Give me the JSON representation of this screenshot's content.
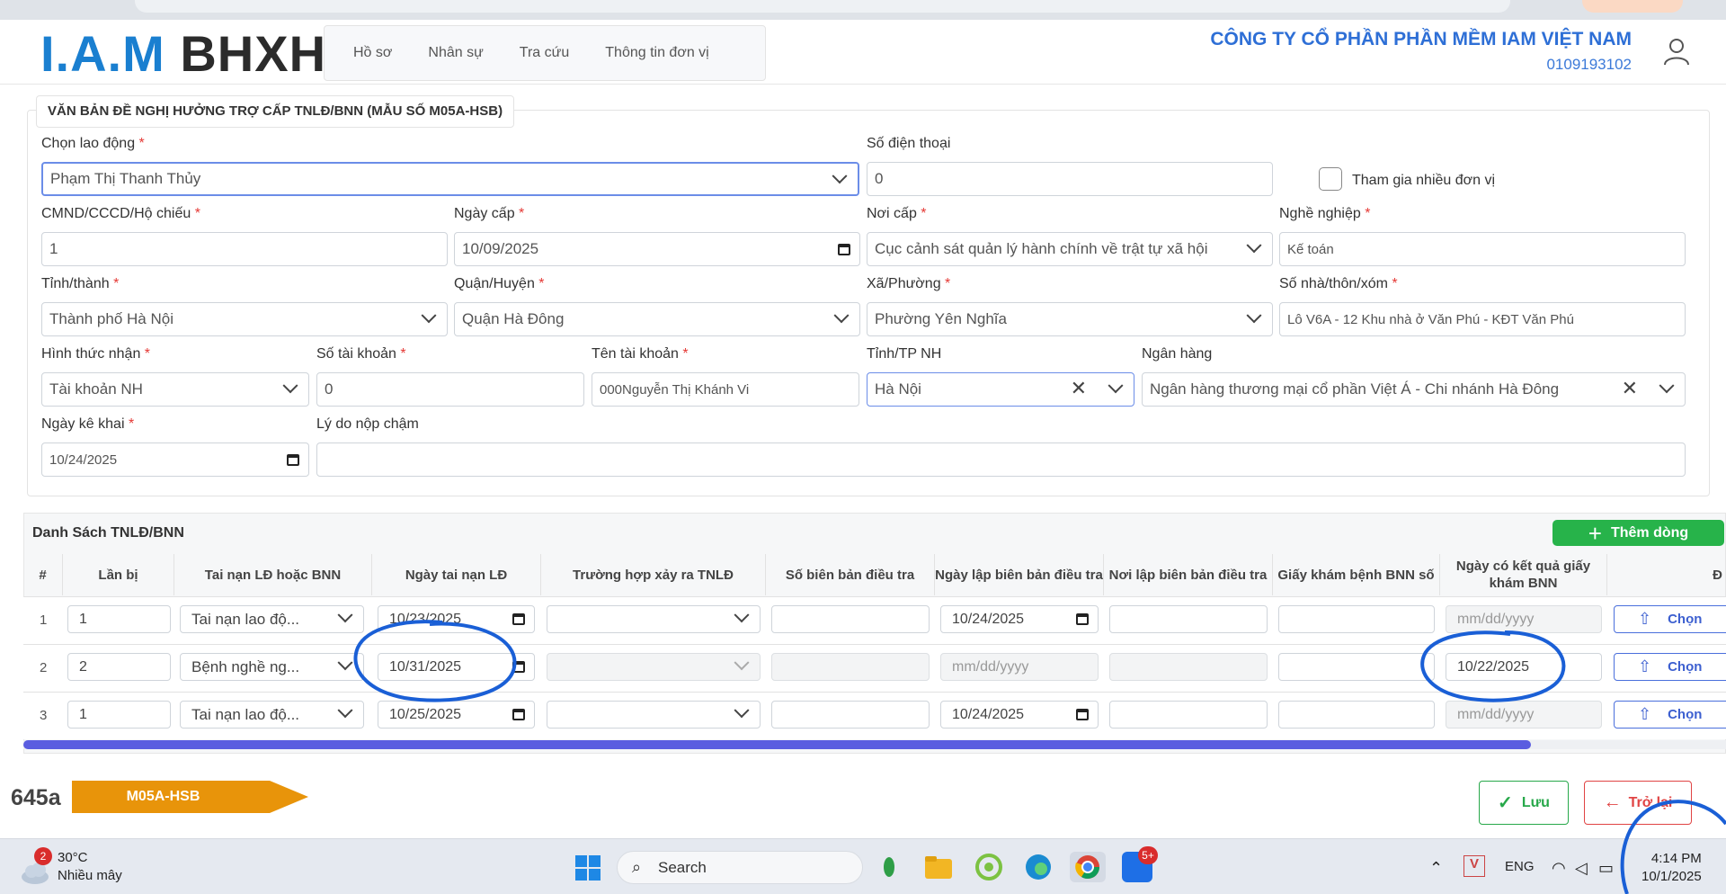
{
  "header": {
    "logo_iam": "I.A.M",
    "logo_bhxh": "BHXH",
    "nav": [
      "Hồ sơ",
      "Nhân sự",
      "Tra cứu",
      "Thông tin đơn vị"
    ],
    "company_name": "CÔNG TY CỔ PHẦN PHẦN MỀM IAM VIỆT NAM",
    "tax_code": "0109193102"
  },
  "form": {
    "title": "VĂN BẢN ĐỀ NGHỊ HƯỞNG TRỢ CẤP TNLĐ/BNN (MẪU SỐ M05A-HSB)",
    "required_mark": "*",
    "chon_lao_dong": {
      "label": "Chọn lao động",
      "value": "Phạm Thị Thanh Thủy"
    },
    "so_dien_thoai": {
      "label": "Số điện thoại",
      "value": "0"
    },
    "tham_gia": {
      "label": "Tham gia nhiều đơn vị"
    },
    "cmnd": {
      "label": "CMND/CCCD/Hộ chiếu",
      "value": "1"
    },
    "ngay_cap": {
      "label": "Ngày cấp",
      "value": "10/09/2025"
    },
    "noi_cap": {
      "label": "Nơi cấp",
      "value": "Cục cảnh sát quản lý hành chính về trật tự xã hội"
    },
    "nghe_nghiep": {
      "label": "Nghề nghiệp",
      "value": "Kế toán"
    },
    "tinh_thanh": {
      "label": "Tỉnh/thành",
      "value": "Thành phố Hà Nội"
    },
    "quan_huyen": {
      "label": "Quận/Huyện",
      "value": "Quận Hà Đông"
    },
    "xa_phuong": {
      "label": "Xã/Phường",
      "value": "Phường Yên Nghĩa"
    },
    "so_nha": {
      "label": "Số nhà/thôn/xóm",
      "value": "Lô V6A - 12 Khu nhà ở Văn Phú - KĐT Văn Phú"
    },
    "hinh_thuc_nhan": {
      "label": "Hình thức nhận",
      "value": "Tài khoản NH"
    },
    "so_tai_khoan": {
      "label": "Số tài khoản",
      "value": "0"
    },
    "ten_tai_khoan": {
      "label": "Tên tài khoản",
      "value": "000Nguyễn Thị Khánh Vi"
    },
    "tinh_tp_nh": {
      "label": "Tỉnh/TP NH",
      "value": "Hà Nội"
    },
    "ngan_hang": {
      "label": "Ngân hàng",
      "value": "Ngân hàng thương mại cổ phần Việt Á - Chi nhánh Hà Đông"
    },
    "ngay_ke_khai": {
      "label": "Ngày kê khai",
      "value": "10/24/2025"
    },
    "ly_do": {
      "label": "Lý do nộp chậm",
      "value": ""
    }
  },
  "table": {
    "title": "Danh Sách TNLĐ/BNN",
    "add_button": "Thêm dòng",
    "columns": [
      "#",
      "Lần bị",
      "Tai nạn LĐ hoặc BNN",
      "Ngày tai nạn LĐ",
      "Trường hợp xảy ra TNLĐ",
      "Số biên bản điều tra",
      "Ngày lập biên bản điều tra",
      "Nơi lập biên bản điều tra",
      "Giấy khám bệnh BNN số",
      "Ngày có kết quả giấy khám BNN",
      "Đ"
    ],
    "date_placeholder": "mm/dd/yyyy",
    "upload_label": "Chọn",
    "rows": [
      {
        "num": "1",
        "lan_bi": "1",
        "loai": "Tai nạn lao độ...",
        "ngay_tn": "10/23/2025",
        "ngay_lap": "10/24/2025",
        "ngay_kq": ""
      },
      {
        "num": "2",
        "lan_bi": "2",
        "loai": "Bệnh nghề ng...",
        "ngay_tn": "10/31/2025",
        "ngay_lap": "",
        "ngay_kq": "10/22/2025"
      },
      {
        "num": "3",
        "lan_bi": "1",
        "loai": "Tai nạn lao độ...",
        "ngay_tn": "10/25/2025",
        "ngay_lap": "10/24/2025",
        "ngay_kq": ""
      }
    ]
  },
  "footer": {
    "code": "645a",
    "banner": "M05A-HSB",
    "save": "Lưu",
    "back": "Trở lại"
  },
  "taskbar": {
    "weather_badge": "2",
    "temp": "30°C",
    "weather_desc": "Nhiều mây",
    "search": "Search",
    "zalo_badge": "5+",
    "lang": "ENG",
    "time": "4:14 PM",
    "date": "10/1/2025"
  },
  "colors": {
    "brand_blue": "#1a7fd0",
    "company_blue": "#2e6fd6",
    "required_red": "#e53935",
    "add_green": "#27b34a",
    "banner_orange": "#e8940a",
    "annotation_blue": "#1a5fd6"
  }
}
